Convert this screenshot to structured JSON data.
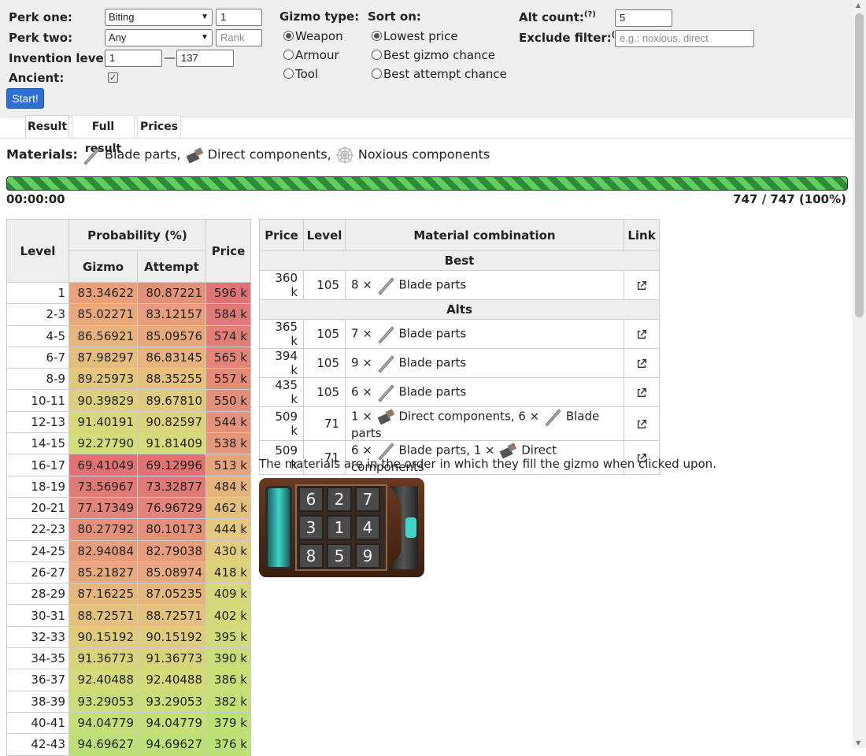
{
  "form": {
    "perk_one_label": "Perk one:",
    "perk_one_value": "Biting",
    "perk_one_rank": "1",
    "perk_two_label": "Perk two:",
    "perk_two_value": "Any",
    "perk_two_rank_placeholder": "Rank",
    "invention_level_label": "Invention level:",
    "level_from": "1",
    "level_separator": "—",
    "level_to": "137",
    "ancient_label": "Ancient:",
    "ancient_checked": true,
    "start_label": "Start!",
    "gizmo_type_label": "Gizmo type:",
    "gizmo_types": [
      {
        "label": "Weapon",
        "selected": true
      },
      {
        "label": "Armour",
        "selected": false
      },
      {
        "label": "Tool",
        "selected": false
      }
    ],
    "sort_label": "Sort on:",
    "sort_options": [
      {
        "label": "Lowest price",
        "selected": true
      },
      {
        "label": "Best gizmo chance",
        "selected": false
      },
      {
        "label": "Best attempt chance",
        "selected": false
      }
    ],
    "alt_count_label": "Alt count:",
    "alt_count_help": "(?)",
    "alt_count_value": "5",
    "exclude_label": "Exclude filter:",
    "exclude_help": "(?)",
    "exclude_placeholder": "e.g.: noxious, direct"
  },
  "tabs": [
    "Result",
    "Full result",
    "Prices"
  ],
  "materials": {
    "label": "Materials:",
    "items": [
      "Blade parts,",
      "Direct components,",
      "Noxious components"
    ]
  },
  "progress": {
    "fraction": 1.0,
    "timer": "00:00:00",
    "count": "747 / 747 (100%)"
  },
  "level_table": {
    "headers": {
      "level": "Level",
      "probability": "Probability (%)",
      "gizmo": "Gizmo",
      "attempt": "Attempt",
      "price": "Price"
    },
    "rows": [
      {
        "level": "1",
        "gizmo": "83.34622",
        "attempt": "80.87221",
        "price": "596 k",
        "gc": "#e9a17c",
        "ac": "#e4917a",
        "pc": "#e07474"
      },
      {
        "level": "2-3",
        "gizmo": "85.02271",
        "attempt": "83.12157",
        "price": "584 k",
        "gc": "#e8aa7d",
        "ac": "#e69e7b",
        "pc": "#e07a76"
      },
      {
        "level": "4-5",
        "gizmo": "86.56921",
        "attempt": "85.09576",
        "price": "574 k",
        "gc": "#e7b47d",
        "ac": "#e8aa7d",
        "pc": "#e17f77"
      },
      {
        "level": "6-7",
        "gizmo": "87.98297",
        "attempt": "86.83145",
        "price": "565 k",
        "gc": "#e5be7d",
        "ac": "#e7b47d",
        "pc": "#e28578"
      },
      {
        "level": "8-9",
        "gizmo": "89.25973",
        "attempt": "88.35255",
        "price": "557 k",
        "gc": "#e2c87d",
        "ac": "#e4c07d",
        "pc": "#e38a79"
      },
      {
        "level": "10-11",
        "gizmo": "90.39829",
        "attempt": "89.67810",
        "price": "550 k",
        "gc": "#ddd07c",
        "ac": "#e0ca7d",
        "pc": "#e38f79"
      },
      {
        "level": "12-13",
        "gizmo": "91.40191",
        "attempt": "90.82597",
        "price": "544 k",
        "gc": "#d8d87a",
        "ac": "#dbd37b",
        "pc": "#e4937a"
      },
      {
        "level": "14-15",
        "gizmo": "92.27790",
        "attempt": "91.81409",
        "price": "538 k",
        "gc": "#d2de79",
        "ac": "#d5da7a",
        "pc": "#e4977a"
      },
      {
        "level": "16-17",
        "gizmo": "69.41049",
        "attempt": "69.12996",
        "price": "513 k",
        "gc": "#e07272",
        "ac": "#e07272",
        "pc": "#e5a47c"
      },
      {
        "level": "18-19",
        "gizmo": "73.56967",
        "attempt": "73.32877",
        "price": "484 k",
        "gc": "#e17a76",
        "ac": "#e17a76",
        "pc": "#e6b37d"
      },
      {
        "level": "20-21",
        "gizmo": "77.17349",
        "attempt": "76.96729",
        "price": "462 k",
        "gc": "#e2847a",
        "ac": "#e2847a",
        "pc": "#e7bf7d"
      },
      {
        "level": "22-23",
        "gizmo": "80.27792",
        "attempt": "80.10173",
        "price": "444 k",
        "gc": "#e4907b",
        "ac": "#e4907b",
        "pc": "#e4c87d"
      },
      {
        "level": "24-25",
        "gizmo": "82.94084",
        "attempt": "82.79038",
        "price": "430 k",
        "gc": "#e69d7c",
        "ac": "#e69d7c",
        "pc": "#e0cd7d"
      },
      {
        "level": "26-27",
        "gizmo": "85.21827",
        "attempt": "85.08974",
        "price": "418 k",
        "gc": "#e8aa7d",
        "ac": "#e8aa7d",
        "pc": "#dcd27c"
      },
      {
        "level": "28-29",
        "gizmo": "87.16225",
        "attempt": "87.05235",
        "price": "409 k",
        "gc": "#e7b67d",
        "ac": "#e7b67d",
        "pc": "#d8d67b"
      },
      {
        "level": "30-31",
        "gizmo": "88.72571",
        "attempt": "88.72571",
        "price": "402 k",
        "gc": "#e4c27d",
        "ac": "#e4c27d",
        "pc": "#d4d97a"
      },
      {
        "level": "32-33",
        "gizmo": "90.15192",
        "attempt": "90.15192",
        "price": "395 k",
        "gc": "#dfcc7c",
        "ac": "#dfcc7c",
        "pc": "#cfdc79"
      },
      {
        "level": "34-35",
        "gizmo": "91.36773",
        "attempt": "91.36773",
        "price": "390 k",
        "gc": "#d9d47b",
        "ac": "#d9d47b",
        "pc": "#cadd78"
      },
      {
        "level": "36-37",
        "gizmo": "92.40488",
        "attempt": "92.40488",
        "price": "386 k",
        "gc": "#d2da7a",
        "ac": "#d2da7a",
        "pc": "#c6df77"
      },
      {
        "level": "38-39",
        "gizmo": "93.29053",
        "attempt": "93.29053",
        "price": "382 k",
        "gc": "#cbdd79",
        "ac": "#cbdd79",
        "pc": "#c2e076"
      },
      {
        "level": "40-41",
        "gizmo": "94.04779",
        "attempt": "94.04779",
        "price": "379 k",
        "gc": "#c4df77",
        "ac": "#c4df77",
        "pc": "#bee175"
      },
      {
        "level": "42-43",
        "gizmo": "94.69627",
        "attempt": "94.69627",
        "price": "376 k",
        "gc": "#bde175",
        "ac": "#bde175",
        "pc": "#bae274"
      }
    ]
  },
  "result_table": {
    "headers": {
      "price": "Price",
      "level": "Level",
      "combo": "Material combination",
      "link": "Link"
    },
    "best_label": "Best",
    "alts_label": "Alts",
    "best": {
      "price": "360 k",
      "level": "105",
      "parts": [
        {
          "qty": "8 ×",
          "mat": "blade",
          "name": "Blade parts"
        }
      ]
    },
    "alts": [
      {
        "price": "365 k",
        "level": "105",
        "parts": [
          {
            "qty": "7 ×",
            "mat": "blade",
            "name": "Blade parts"
          }
        ]
      },
      {
        "price": "394 k",
        "level": "105",
        "parts": [
          {
            "qty": "9 ×",
            "mat": "blade",
            "name": "Blade parts"
          }
        ]
      },
      {
        "price": "435 k",
        "level": "105",
        "parts": [
          {
            "qty": "6 ×",
            "mat": "blade",
            "name": "Blade parts"
          }
        ]
      },
      {
        "price": "509 k",
        "level": "71",
        "parts": [
          {
            "qty": "1 ×",
            "mat": "direct",
            "name": "Direct components,"
          },
          {
            "qty": "6 ×",
            "mat": "blade",
            "name": "Blade parts"
          }
        ]
      },
      {
        "price": "509 k",
        "level": "71",
        "parts": [
          {
            "qty": "6 ×",
            "mat": "blade",
            "name": "Blade parts,"
          },
          {
            "qty": "1 ×",
            "mat": "direct",
            "name": "Direct components"
          }
        ]
      }
    ]
  },
  "note": "The materials are in the order in which they fill the gizmo when clicked upon.",
  "gizmo_grid": [
    "6",
    "2",
    "7",
    "3",
    "1",
    "4",
    "8",
    "5",
    "9"
  ]
}
